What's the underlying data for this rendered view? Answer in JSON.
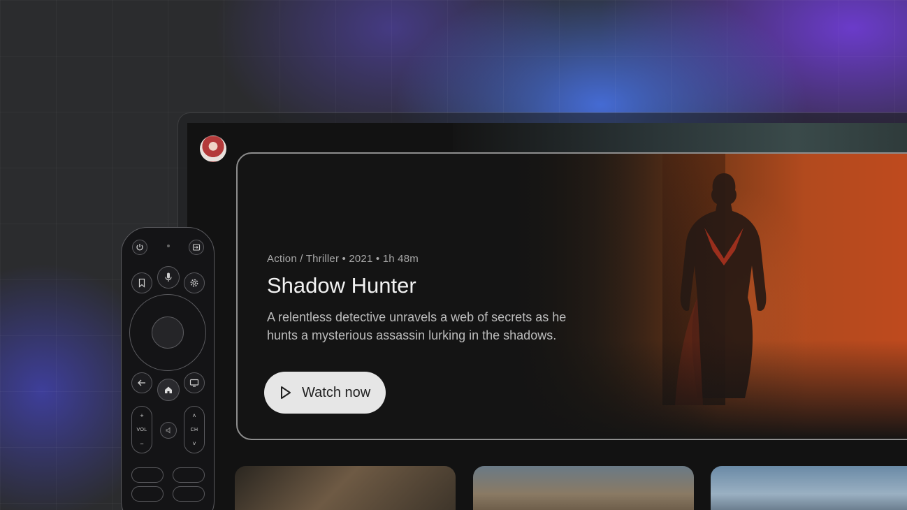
{
  "hero": {
    "meta": "Action / Thriller • 2021 • 1h 48m",
    "title": "Shadow Hunter",
    "description": "A relentless detective unravels a web of secrets as he hunts a mysterious assassin lurking in the shadows.",
    "watch_label": "Watch now"
  },
  "remote": {
    "vol_label": "VOL",
    "ch_label": "CH",
    "plus": "+",
    "minus": "−",
    "up": "˄",
    "down": "˅"
  },
  "icons": {
    "power": "power-icon",
    "input": "input-icon",
    "bookmark": "bookmark-icon",
    "mic": "mic-icon",
    "settings": "gear-icon",
    "back": "back-arrow-icon",
    "home": "home-icon",
    "tv": "tv-icon",
    "mute": "mute-icon",
    "play": "play-icon"
  },
  "colors": {
    "button_bg": "#e6e6e6",
    "accent_blue": "#466edc",
    "accent_purple": "#6e3cd2"
  }
}
